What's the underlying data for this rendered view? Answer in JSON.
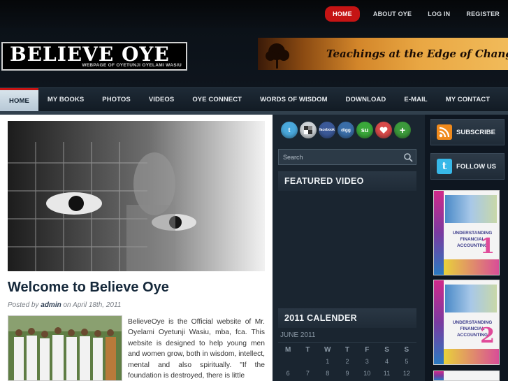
{
  "top_nav": {
    "items": [
      "HOME",
      "ABOUT OYE",
      "LOG IN",
      "REGISTER"
    ],
    "active_color": "#c51414"
  },
  "header": {
    "logo_title": "BELIEVE OYE",
    "logo_subtitle": "WEBPAGE OF OYETUNJI OYELAMI WASIU",
    "banner_text": "Teachings at the Edge of Change"
  },
  "main_nav": {
    "items": [
      "HOME",
      "MY BOOKS",
      "PHOTOS",
      "VIDEOS",
      "OYE CONNECT",
      "WORDS OF WISDOM",
      "DOWNLOAD",
      "E-MAIL",
      "MY CONTACT"
    ]
  },
  "post": {
    "title": "Welcome to Believe Oye",
    "meta_prefix": "Posted by",
    "author": "admin",
    "meta_on": "on April 18th, 2011",
    "body": "BelieveOye is the Official website of Mr. Oyelami Oyetunji Wasiu, mba, fca. This website is designed to help young men and women grow, both in wisdom, intellect, mental and also spiritually. \"If the foundation is destroyed, there is little"
  },
  "sidebar": {
    "social_icons": [
      "twitter-icon",
      "delicious-icon",
      "facebook-icon",
      "digg-icon",
      "stumbleupon-icon",
      "favorite-icon",
      "add-icon"
    ],
    "social_labels": [
      "t",
      "",
      "facebook",
      "digg",
      "su",
      "",
      "+"
    ],
    "search_placeholder": "Search",
    "featured_video_title": "FEATURED VIDEO",
    "calendar_title": "2011 CALENDER",
    "calendar_month": "JUNE 2011",
    "calendar_days": [
      "M",
      "T",
      "W",
      "T",
      "F",
      "S",
      "S"
    ],
    "calendar_row1": [
      "",
      "",
      "1",
      "2",
      "3",
      "4",
      "5"
    ],
    "calendar_row2": [
      "6",
      "7",
      "8",
      "9",
      "10",
      "11",
      "12"
    ]
  },
  "right_sidebar": {
    "subscribe_label": "SUBSCRIBE",
    "follow_label": "FOLLOW US",
    "book1_title": "UNDERSTANDING FINANCIAL ACCOUNTING",
    "book1_num": "1",
    "book2_title": "UNDERSTANDING FINANCIAL ACCOUNTING",
    "book2_num": "2"
  }
}
